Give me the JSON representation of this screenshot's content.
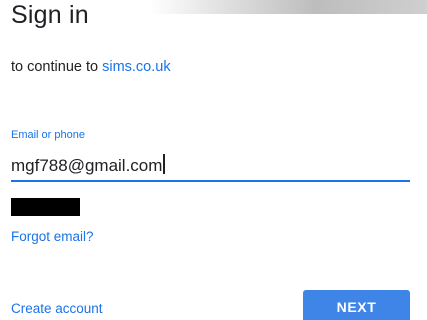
{
  "header": {
    "title": "Sign in",
    "subtitle_prefix": "to continue to ",
    "subtitle_link": "sims.co.uk"
  },
  "email_field": {
    "label": "Email or phone",
    "value": "mgf788@gmail.com"
  },
  "links": {
    "forgot_email": "Forgot email?",
    "create_account": "Create account"
  },
  "buttons": {
    "next": "NEXT"
  },
  "colors": {
    "accent": "#1a73e8",
    "button": "#3f85e8",
    "text": "#202124",
    "redaction": "#000000"
  }
}
